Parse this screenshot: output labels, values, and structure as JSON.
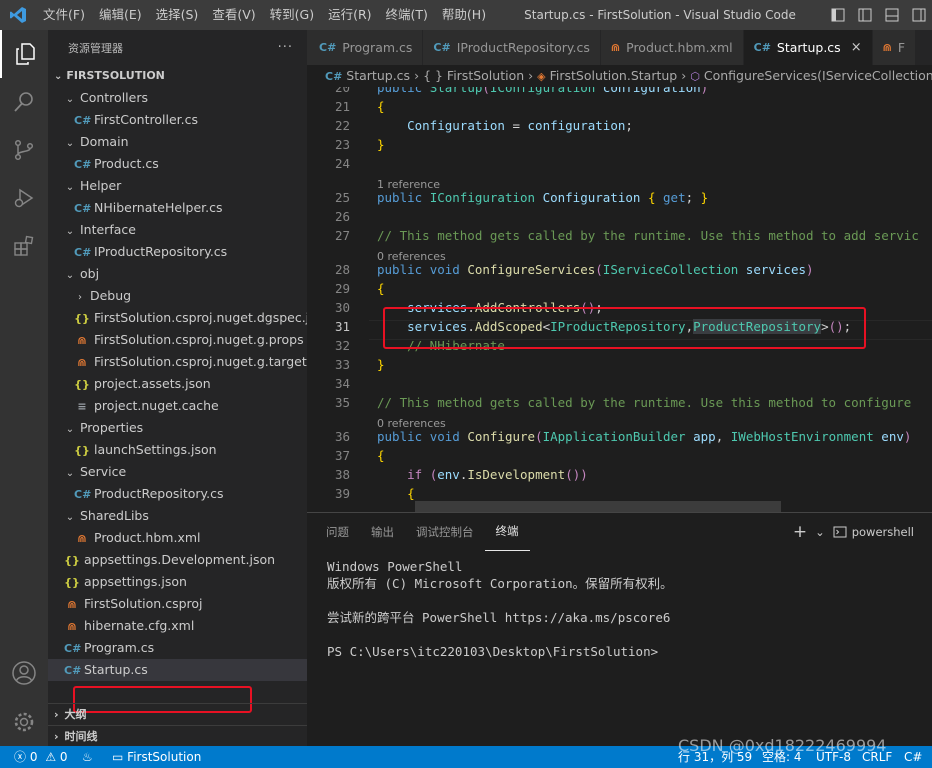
{
  "titlebar": {
    "logo_icon": "vscode-logo-icon",
    "menus": [
      "文件(F)",
      "编辑(E)",
      "选择(S)",
      "查看(V)",
      "转到(G)",
      "运行(R)",
      "终端(T)",
      "帮助(H)"
    ],
    "window_title": "Startup.cs - FirstSolution - Visual Studio Code",
    "controls": [
      "layout-icon",
      "layout-split-icon",
      "minimize-icon",
      "maximize-icon"
    ]
  },
  "activity": {
    "top": [
      "explorer-icon",
      "search-icon",
      "source-control-icon",
      "run-debug-icon",
      "extensions-icon"
    ],
    "bottom": [
      "account-icon",
      "manage-gear-icon"
    ]
  },
  "sidebar": {
    "title": "资源管理器",
    "more": "···",
    "root": "FIRSTSOLUTION",
    "tree": [
      {
        "label": "Controllers",
        "type": "folder",
        "open": true,
        "depth": 1
      },
      {
        "label": "FirstController.cs",
        "type": "cs",
        "depth": 2
      },
      {
        "label": "Domain",
        "type": "folder",
        "open": true,
        "depth": 1
      },
      {
        "label": "Product.cs",
        "type": "cs",
        "depth": 2
      },
      {
        "label": "Helper",
        "type": "folder",
        "open": true,
        "depth": 1
      },
      {
        "label": "NHibernateHelper.cs",
        "type": "cs",
        "depth": 2
      },
      {
        "label": "Interface",
        "type": "folder",
        "open": true,
        "depth": 1
      },
      {
        "label": "IProductRepository.cs",
        "type": "cs",
        "depth": 2
      },
      {
        "label": "obj",
        "type": "folder",
        "open": true,
        "depth": 1
      },
      {
        "label": "Debug",
        "type": "folder",
        "open": false,
        "depth": 2
      },
      {
        "label": "FirstSolution.csproj.nuget.dgspec.json",
        "type": "json",
        "depth": 2
      },
      {
        "label": "FirstSolution.csproj.nuget.g.props",
        "type": "xml",
        "depth": 2
      },
      {
        "label": "FirstSolution.csproj.nuget.g.targets",
        "type": "xml",
        "depth": 2
      },
      {
        "label": "project.assets.json",
        "type": "json",
        "depth": 2
      },
      {
        "label": "project.nuget.cache",
        "type": "cache",
        "depth": 2
      },
      {
        "label": "Properties",
        "type": "folder",
        "open": true,
        "depth": 1
      },
      {
        "label": "launchSettings.json",
        "type": "json",
        "depth": 2
      },
      {
        "label": "Service",
        "type": "folder",
        "open": true,
        "depth": 1
      },
      {
        "label": "ProductRepository.cs",
        "type": "cs",
        "depth": 2
      },
      {
        "label": "SharedLibs",
        "type": "folder",
        "open": true,
        "depth": 1
      },
      {
        "label": "Product.hbm.xml",
        "type": "xml",
        "depth": 2
      },
      {
        "label": "appsettings.Development.json",
        "type": "json",
        "depth": 1
      },
      {
        "label": "appsettings.json",
        "type": "json",
        "depth": 1
      },
      {
        "label": "FirstSolution.csproj",
        "type": "xml",
        "depth": 1
      },
      {
        "label": "hibernate.cfg.xml",
        "type": "xml",
        "depth": 1
      },
      {
        "label": "Program.cs",
        "type": "cs",
        "depth": 1
      },
      {
        "label": "Startup.cs",
        "type": "cs",
        "depth": 1,
        "selected": true
      }
    ],
    "outline": "大纲",
    "timeline": "时间线"
  },
  "tabs": [
    {
      "label": "Program.cs",
      "type": "cs"
    },
    {
      "label": "IProductRepository.cs",
      "type": "cs"
    },
    {
      "label": "Product.hbm.xml",
      "type": "xml"
    },
    {
      "label": "Startup.cs",
      "type": "cs",
      "active": true,
      "close": "×"
    },
    {
      "label": "F",
      "type": "xml"
    }
  ],
  "breadcrumb": [
    "Startup.cs",
    "{ } FirstSolution",
    "FirstSolution.Startup",
    "ConfigureServices(IServiceCollection servic"
  ],
  "editor": {
    "lines": [
      {
        "n": "20",
        "text": "public Startup(IConfiguration configuration)"
      },
      {
        "n": "21",
        "text": "{"
      },
      {
        "n": "22",
        "text": "    Configuration = configuration;"
      },
      {
        "n": "23",
        "text": "}"
      },
      {
        "n": "24",
        "text": ""
      },
      {
        "lens": "1 reference"
      },
      {
        "n": "25",
        "text": "public IConfiguration Configuration { get; }"
      },
      {
        "n": "26",
        "text": ""
      },
      {
        "n": "27",
        "text": "// This method gets called by the runtime. Use this method to add servic"
      },
      {
        "lens": "0 references"
      },
      {
        "n": "28",
        "text": "public void ConfigureServices(IServiceCollection services)"
      },
      {
        "n": "29",
        "text": "{"
      },
      {
        "n": "30",
        "text": "    services.AddControllers();"
      },
      {
        "n": "31",
        "text": "    services.AddScoped<IProductRepository,ProductRepository>();"
      },
      {
        "n": "32",
        "text": "    // NHibernate"
      },
      {
        "n": "33",
        "text": "}"
      },
      {
        "n": "34",
        "text": ""
      },
      {
        "n": "35",
        "text": "// This method gets called by the runtime. Use this method to configure"
      },
      {
        "lens": "0 references"
      },
      {
        "n": "36",
        "text": "public void Configure(IApplicationBuilder app, IWebHostEnvironment env)"
      },
      {
        "n": "37",
        "text": "{"
      },
      {
        "n": "38",
        "text": "    if (env.IsDevelopment())"
      },
      {
        "n": "39",
        "text": "    {"
      }
    ]
  },
  "panel": {
    "tabs": [
      "问题",
      "输出",
      "调试控制台",
      "终端"
    ],
    "active_tab": "终端",
    "right": {
      "add": "+",
      "dropdown": "⌄",
      "shell": "powershell"
    },
    "terminal": [
      "Windows PowerShell",
      "版权所有 (C) Microsoft Corporation。保留所有权利。",
      "",
      "尝试新的跨平台 PowerShell https://aka.ms/pscore6",
      "",
      "PS C:\\Users\\itc220103\\Desktop\\FirstSolution>"
    ]
  },
  "statusbar": {
    "errors": "0",
    "warnings": "0",
    "project": "FirstSolution",
    "position": "行 31，列 59",
    "spaces": "空格: 4",
    "encoding": "UTF-8",
    "eol": "CRLF",
    "language": "C#"
  },
  "watermark": "CSDN @0xd18222469994",
  "colors": {
    "accent": "#007acc",
    "highlight_box": "#e81123"
  }
}
